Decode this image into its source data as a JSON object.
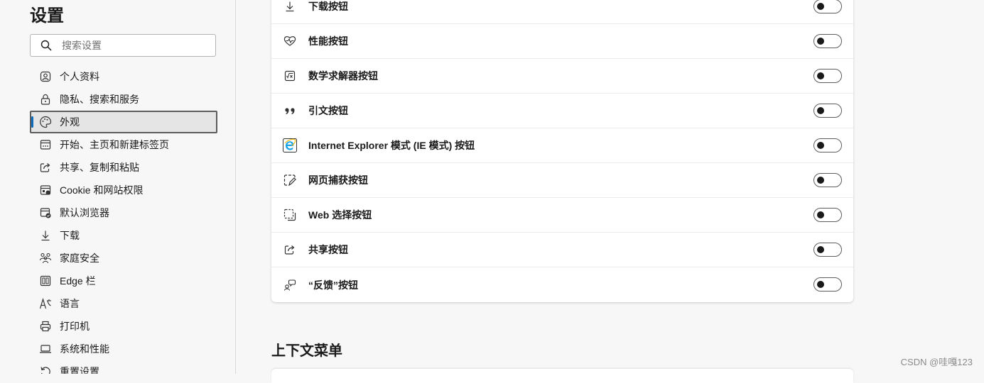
{
  "sidebar": {
    "title": "设置",
    "search_placeholder": "搜索设置",
    "items": [
      {
        "label": "个人资料",
        "icon": "profile-icon"
      },
      {
        "label": "隐私、搜索和服务",
        "icon": "lock-icon"
      },
      {
        "label": "外观",
        "icon": "palette-icon",
        "active": true
      },
      {
        "label": "开始、主页和新建标签页",
        "icon": "home-page-icon"
      },
      {
        "label": "共享、复制和粘贴",
        "icon": "share-icon"
      },
      {
        "label": "Cookie 和网站权限",
        "icon": "site-permissions-icon"
      },
      {
        "label": "默认浏览器",
        "icon": "default-browser-icon"
      },
      {
        "label": "下载",
        "icon": "download-icon"
      },
      {
        "label": "家庭安全",
        "icon": "family-icon"
      },
      {
        "label": "Edge 栏",
        "icon": "edge-bar-icon"
      },
      {
        "label": "语言",
        "icon": "language-icon"
      },
      {
        "label": "打印机",
        "icon": "printer-icon"
      },
      {
        "label": "系统和性能",
        "icon": "laptop-icon"
      },
      {
        "label": "重置设置",
        "icon": "reset-icon"
      }
    ]
  },
  "toolbar_buttons": {
    "rows": [
      {
        "label": "下载按钮",
        "icon": "download-icon",
        "enabled": false
      },
      {
        "label": "性能按钮",
        "icon": "heartbeat-icon",
        "enabled": false
      },
      {
        "label": "数学求解器按钮",
        "icon": "math-solver-icon",
        "enabled": false
      },
      {
        "label": "引文按钮",
        "icon": "quote-icon",
        "enabled": false
      },
      {
        "label": "Internet Explorer 模式 (IE 模式) 按钮",
        "icon": "internet-explorer-icon",
        "enabled": false
      },
      {
        "label": "网页捕获按钮",
        "icon": "web-capture-icon",
        "enabled": false
      },
      {
        "label": "Web 选择按钮",
        "icon": "web-select-icon",
        "enabled": false
      },
      {
        "label": "共享按钮",
        "icon": "share-icon",
        "enabled": false
      },
      {
        "label": "“反馈”按钮",
        "icon": "feedback-icon",
        "enabled": false
      }
    ]
  },
  "context_menu": {
    "title": "上下文菜单"
  },
  "watermark": "CSDN @哇嘎123",
  "colors": {
    "accent": "#0f6cbd",
    "ie_blue": "#1aa1e6"
  }
}
